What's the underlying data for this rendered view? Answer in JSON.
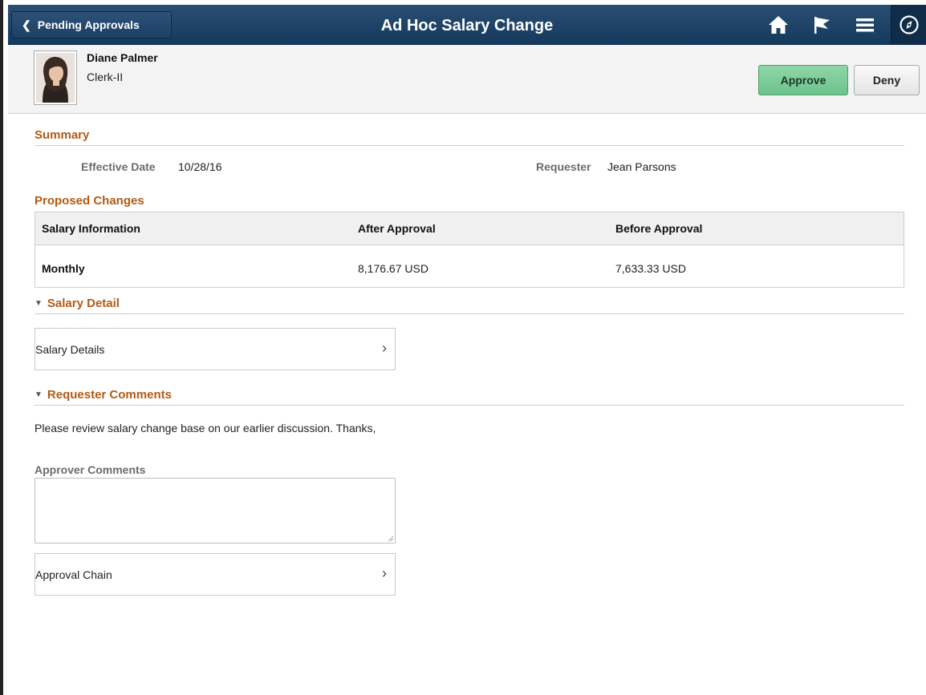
{
  "header": {
    "back_label": "Pending Approvals",
    "title": "Ad Hoc Salary Change",
    "icons": [
      "home-icon",
      "flag-icon",
      "menu-icon",
      "navbar-compass-icon"
    ]
  },
  "employee": {
    "name": "Diane Palmer",
    "title": "Clerk-II"
  },
  "actions": {
    "approve_label": "Approve",
    "deny_label": "Deny"
  },
  "summary": {
    "heading": "Summary",
    "effective_date_label": "Effective Date",
    "effective_date_value": "10/28/16",
    "requester_label": "Requester",
    "requester_value": "Jean Parsons"
  },
  "proposed_changes": {
    "heading": "Proposed Changes",
    "columns": [
      "Salary Information",
      "After Approval",
      "Before Approval"
    ],
    "rows": [
      [
        "Monthly",
        "8,176.67 USD",
        "7,633.33 USD"
      ]
    ]
  },
  "salary_detail": {
    "heading": "Salary Detail",
    "link_label": "Salary Details"
  },
  "requester_comments": {
    "heading": "Requester Comments",
    "text": "Please review salary change base on our earlier discussion. Thanks,"
  },
  "approver_comments": {
    "label": "Approver Comments",
    "value": ""
  },
  "approval_chain": {
    "link_label": "Approval Chain"
  },
  "colors": {
    "header_bg": "#1d4066",
    "section_heading": "#b15b16",
    "approve_bg": "#6cc28c"
  }
}
